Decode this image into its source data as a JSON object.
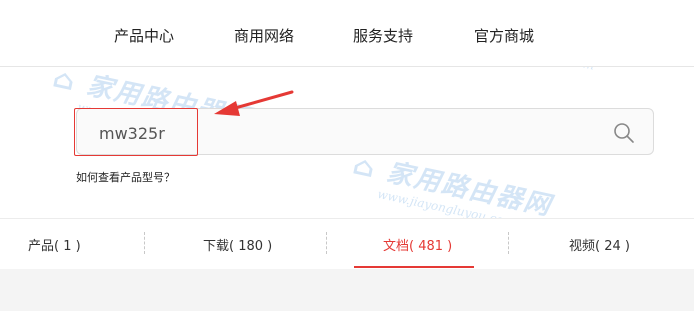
{
  "nav": {
    "items": [
      {
        "label": "产品中心"
      },
      {
        "label": "商用网络"
      },
      {
        "label": "服务支持"
      },
      {
        "label": "官方商城"
      }
    ]
  },
  "search": {
    "value": "mw325r",
    "icon": "search-icon"
  },
  "help": {
    "label": "如何查看产品型号？"
  },
  "tabs": [
    {
      "label": "产品( 1 )",
      "active": false
    },
    {
      "label": "下载( 180 )",
      "active": false
    },
    {
      "label": "文档( 481 )",
      "active": true
    },
    {
      "label": "视频( 24 )",
      "active": false
    }
  ],
  "colors": {
    "accent": "#e53935",
    "watermark": "#3f8ed8"
  },
  "watermark": {
    "logo_text": "家用路由器网",
    "url_text": "www.jiayongluyou.com"
  }
}
